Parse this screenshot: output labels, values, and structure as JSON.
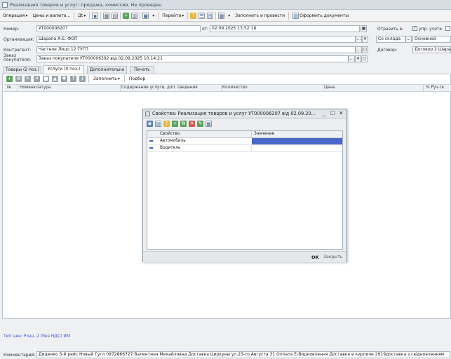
{
  "window": {
    "title": "Реализация товаров и услуг: продажа, комиссия. Не проведен"
  },
  "toolbar": {
    "operation_label": "Операция",
    "prices_label": "Цены и валюта...",
    "di_label": "Дt",
    "go_label": "Перейти",
    "fill_and_post_label": "Заполнить и провести",
    "print_docs_label": "Оформить документы"
  },
  "header": {
    "number_label": "Номер:",
    "number_value": "УТ000006207",
    "date_label": "от:",
    "date_value": "02.09.2025 13:52:18",
    "reflect_label": "Отразить в:",
    "mgmt_acc_label": "упр. учете",
    "org_label": "Организация:",
    "org_value": "Шарапа А.Є. ФОП",
    "warehouse_value": "Со склада",
    "warehouse_name": "Основной",
    "contractor_label": "Контрагент:",
    "contractor_value": "Частное Лицо 12 ГУГП",
    "contract_label": "Договор:",
    "contract_value": "Договор 2 Шарапа",
    "order_label": "Заказ покупателя:",
    "order_value": "Заказ покупателя УТ000006392 від 02.09.2025 10:14:21"
  },
  "tabs": [
    {
      "label": "Товары (2 поз.)"
    },
    {
      "label": "Услуги (0 поз.)"
    },
    {
      "label": "Дополнительно"
    },
    {
      "label": "Печать"
    }
  ],
  "subtoolbar": {
    "fill_label": "Заполнить",
    "pick_label": "Подбор"
  },
  "grid": {
    "columns": [
      "№",
      "Номенклатура",
      "Содержание услуги, доп. сведения",
      "Количество",
      "Цена",
      "% Руч.ск."
    ]
  },
  "dialog": {
    "title": "Свойства: Реализация товаров и услуг УТ000006207 від 02.09.20...",
    "columns": [
      "Свойство",
      "Значение"
    ],
    "rows": [
      {
        "property": "Автомобиль",
        "value": ""
      },
      {
        "property": "Водитель",
        "value": ""
      }
    ],
    "ok_label": "OK",
    "close_label": "Закрыть"
  },
  "footer": {
    "price_type": "Тип цен: Розн. 2 (без НДС) ИМ",
    "comment_label": "Комментарий:",
    "comment_value": "Диденко 3-й рейс Новый Гугл 0972866727 Валентина Михайловна Доставка Циркуны ул.23-го Августа 31 Оплата Е-Видновлення Доставка в кирпиче 2919доставка з свідновленням"
  },
  "colors": {
    "selected_cell": "#4a67c8",
    "link": "#3b5cc4"
  }
}
